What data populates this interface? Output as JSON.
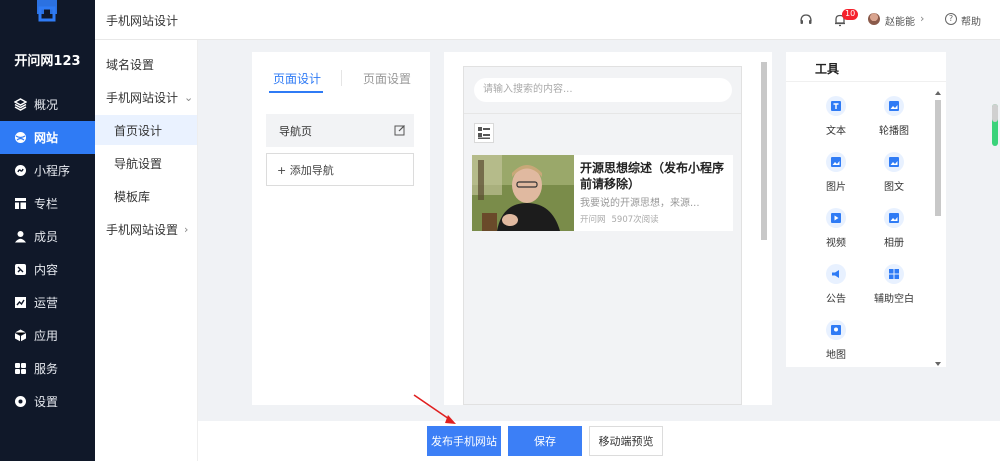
{
  "brand": {
    "name": "开问网123"
  },
  "sidebar": {
    "items": [
      {
        "label": "概况",
        "icon": "dashboard-icon"
      },
      {
        "label": "网站",
        "icon": "globe-icon",
        "active": true
      },
      {
        "label": "小程序",
        "icon": "mini-program-icon"
      },
      {
        "label": "专栏",
        "icon": "column-icon"
      },
      {
        "label": "成员",
        "icon": "user-icon"
      },
      {
        "label": "内容",
        "icon": "content-icon"
      },
      {
        "label": "运营",
        "icon": "chart-icon"
      },
      {
        "label": "应用",
        "icon": "app-icon"
      },
      {
        "label": "服务",
        "icon": "grid-icon"
      },
      {
        "label": "设置",
        "icon": "gear-icon"
      }
    ]
  },
  "header": {
    "title": "手机网站设计",
    "notification_count": "10",
    "user_name": "赵能能",
    "help_label": "帮助"
  },
  "submenu": {
    "items": [
      {
        "label": "域名设置"
      },
      {
        "label": "手机网站设计",
        "expanded": true
      },
      {
        "label": "首页设计",
        "active": true
      },
      {
        "label": "导航设置"
      },
      {
        "label": "模板库"
      },
      {
        "label": "手机网站设置"
      }
    ]
  },
  "editor": {
    "tabs": [
      {
        "label": "页面设计",
        "active": true
      },
      {
        "label": "页面设置"
      }
    ],
    "nav_page_label": "导航页",
    "add_nav_label": "+ 添加导航"
  },
  "preview": {
    "search_placeholder": "请输入搜索的内容...",
    "article": {
      "title": "开源思想综述（发布小程序前请移除）",
      "summary": "我要说的开源思想，来源...",
      "source": "开问网",
      "reads": "5907次阅读"
    }
  },
  "tools": {
    "title": "工具",
    "items": [
      {
        "label": "文本",
        "icon": "text-icon"
      },
      {
        "label": "轮播图",
        "icon": "carousel-icon"
      },
      {
        "label": "图片",
        "icon": "image-icon"
      },
      {
        "label": "图文",
        "icon": "image-text-icon"
      },
      {
        "label": "视频",
        "icon": "video-icon"
      },
      {
        "label": "相册",
        "icon": "album-icon"
      },
      {
        "label": "公告",
        "icon": "announcement-icon"
      },
      {
        "label": "辅助空白",
        "icon": "spacer-icon"
      },
      {
        "label": "地图",
        "icon": "map-icon"
      }
    ]
  },
  "actions": {
    "publish_label": "发布手机网站",
    "save_label": "保存",
    "preview_label": "移动端预览"
  },
  "colors": {
    "sidebar_bg": "#101829",
    "accent": "#2f7bf5",
    "button_primary": "#3c7ff6",
    "arrow": "#e02020"
  }
}
